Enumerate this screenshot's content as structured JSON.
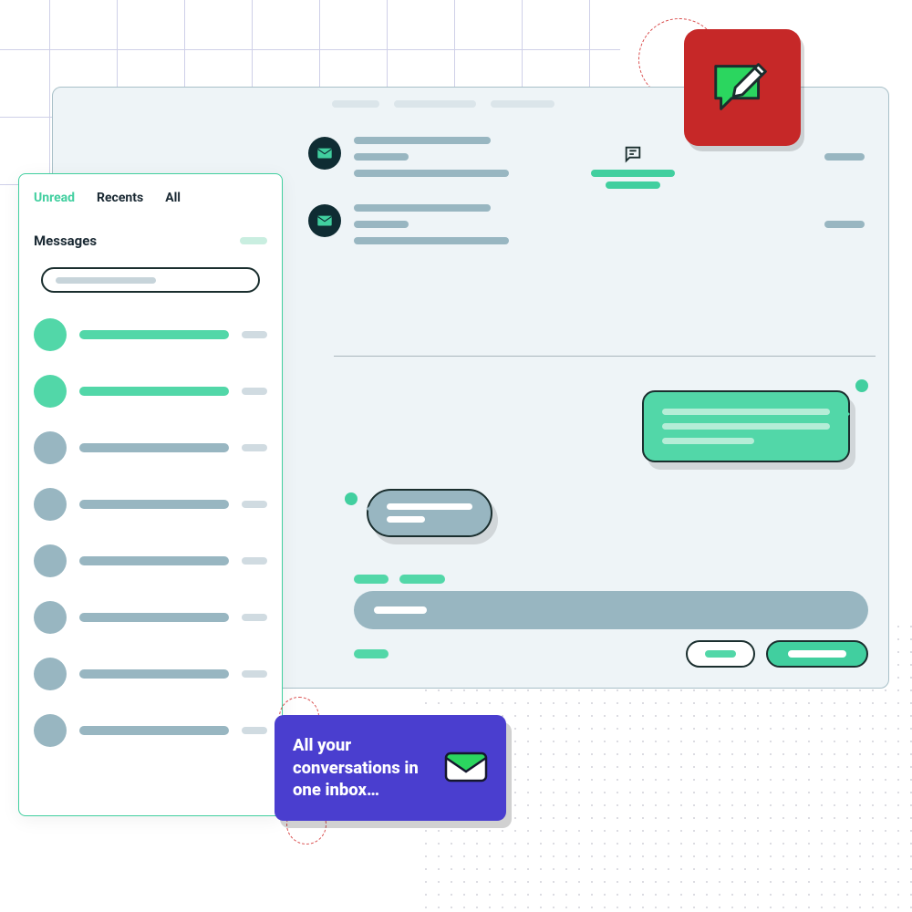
{
  "sidebar": {
    "tabs": [
      {
        "label": "Unread",
        "active": true
      },
      {
        "label": "Recents",
        "active": false
      },
      {
        "label": "All",
        "active": false
      }
    ],
    "section_label": "Messages"
  },
  "promo": {
    "text": "All your conversations in one inbox…"
  },
  "colors": {
    "accent_green": "#41cf9f",
    "panel_bg": "#eef4f7",
    "muted_blue": "#98b6c1",
    "badge_red": "#c62828",
    "promo_purple": "#4a3ecf"
  }
}
